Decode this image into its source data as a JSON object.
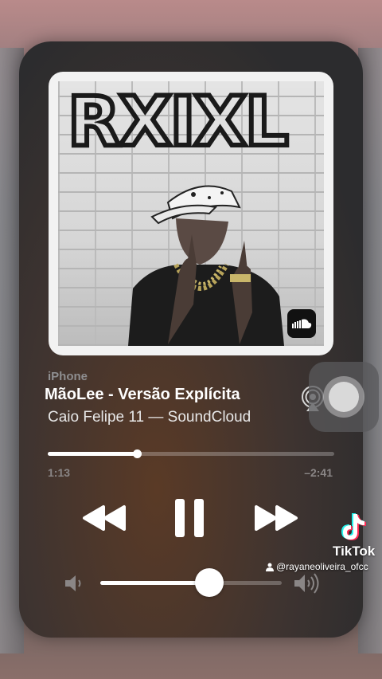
{
  "player": {
    "device": "iPhone",
    "title": "MãoLee  -  Versão Explícita",
    "artist": "Caio Felipe 11 — SoundCloud",
    "progress": {
      "elapsed": "1:13",
      "remaining": "–2:41",
      "fraction": 0.31
    },
    "volume": {
      "fraction": 0.6
    },
    "icons": {
      "airplay": "airplay-icon",
      "rewind": "rewind-icon",
      "pause": "pause-icon",
      "forward": "fast-forward-icon",
      "volume_low": "speaker-low-icon",
      "volume_high": "speaker-high-icon",
      "soundcloud": "soundcloud-icon"
    }
  },
  "album_art": {
    "graffiti_text": "RXIXL"
  },
  "watermark": {
    "brand": "TikTok",
    "username": "@rayaneoliveira_ofcc"
  }
}
